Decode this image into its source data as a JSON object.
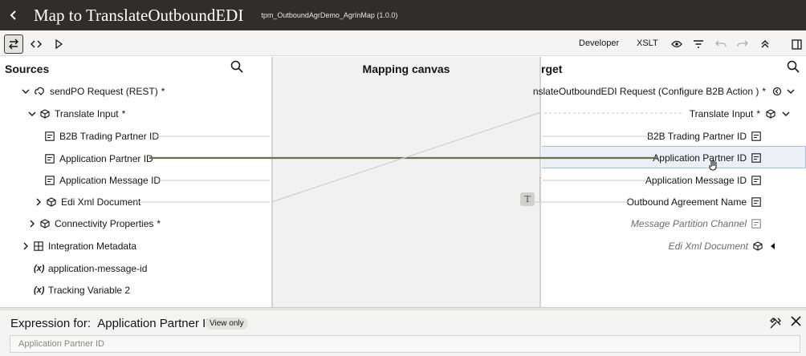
{
  "header": {
    "title": "Map to TranslateOutboundEDI",
    "subtitle": "tpm_OutboundAgrDemo_AgrInMap (1.0.0)"
  },
  "toolbar": {
    "developer_label": "Developer",
    "xslt_label": "XSLT"
  },
  "sources": {
    "title": "Sources",
    "items": [
      {
        "label": "sendPO Request (REST)",
        "required": "*"
      },
      {
        "label": "Translate Input",
        "required": "*"
      },
      {
        "label": "B2B Trading Partner ID"
      },
      {
        "label": "Application Partner ID"
      },
      {
        "label": "Application Message ID"
      },
      {
        "label": "Edi Xml Document"
      },
      {
        "label": "Connectivity Properties",
        "required": "*"
      },
      {
        "label": "Integration Metadata"
      },
      {
        "label": "application-message-id",
        "prefix": "(x)"
      },
      {
        "label": "Tracking Variable 2",
        "prefix": "(x)"
      }
    ]
  },
  "canvas": {
    "title": "Mapping canvas",
    "function_glyph": "T"
  },
  "target": {
    "title": "rget",
    "items": [
      {
        "label": "nslateOutboundEDI Request (Configure B2B Action )",
        "required": "*"
      },
      {
        "label": "Translate Input",
        "required": "*"
      },
      {
        "label": "B2B Trading Partner ID"
      },
      {
        "label": "Application Partner ID"
      },
      {
        "label": "Application Message ID"
      },
      {
        "label": "Outbound Agreement Name"
      },
      {
        "label": "Message Partition Channel"
      },
      {
        "label": "Edi Xml Document"
      }
    ]
  },
  "expression": {
    "label_prefix": "Expression for:",
    "field_name": "Application Partner ID",
    "badge": "View only",
    "value": "Application Partner ID"
  },
  "colors": {
    "header_bg": "#312d2a",
    "mapped_line": "#6b6e4f",
    "link_line": "#c9c7c3",
    "highlight_bg": "#eaf0f6"
  }
}
